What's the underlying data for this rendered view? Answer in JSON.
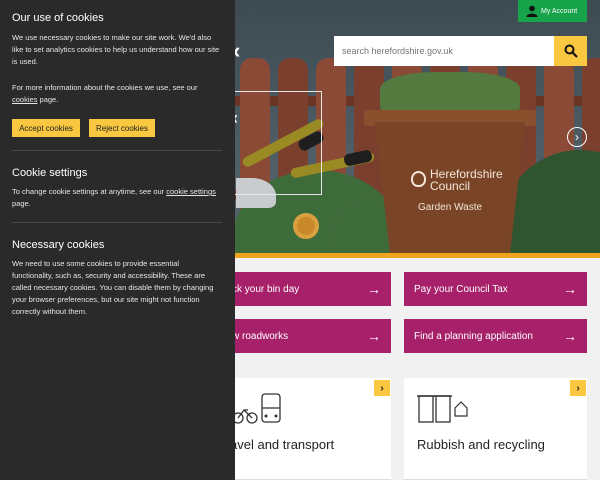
{
  "header": {
    "account_label": "My Account",
    "search_placeholder": "search herefordshire.gov.uk"
  },
  "hero": {
    "bin_brand_line1": "Herefordshire",
    "bin_brand_line2": "Council",
    "bin_label": "Garden Waste"
  },
  "actions": [
    {
      "label": "ck your bin day"
    },
    {
      "label": "Pay your Council Tax"
    },
    {
      "label": "w roadworks"
    },
    {
      "label": "Find a planning application"
    }
  ],
  "cards": [
    {
      "title": "avel and transport",
      "icon": "bus-bike-icon"
    },
    {
      "title": "Rubbish and recycling",
      "icon": "bins-icon"
    }
  ],
  "cookies": {
    "title": "Our use of cookies",
    "intro": "We use necessary cookies to make our site work. We'd also like to set analytics cookies to help us understand how our site is used.",
    "more_info_prefix": "For more information about the cookies we use, see our ",
    "more_info_link": "cookies",
    "more_info_suffix": " page.",
    "accept_label": "Accept cookies",
    "reject_label": "Reject cookies",
    "settings_title": "Cookie settings",
    "settings_prefix": "To change cookie settings at anytime, see our ",
    "settings_link": "cookie settings",
    "settings_suffix": " page.",
    "necessary_title": "Necessary cookies",
    "necessary_text": "We need to use some cookies to provide essential functionality, such as, security and accessibility. These are called necessary cookies. You can disable them by changing your browser preferences, but our site might not function correctly without them."
  },
  "colors": {
    "accent_yellow": "#f9c740",
    "action_magenta": "#a6206a",
    "account_green": "#16a34a",
    "panel_dark": "#2a2a2a"
  }
}
